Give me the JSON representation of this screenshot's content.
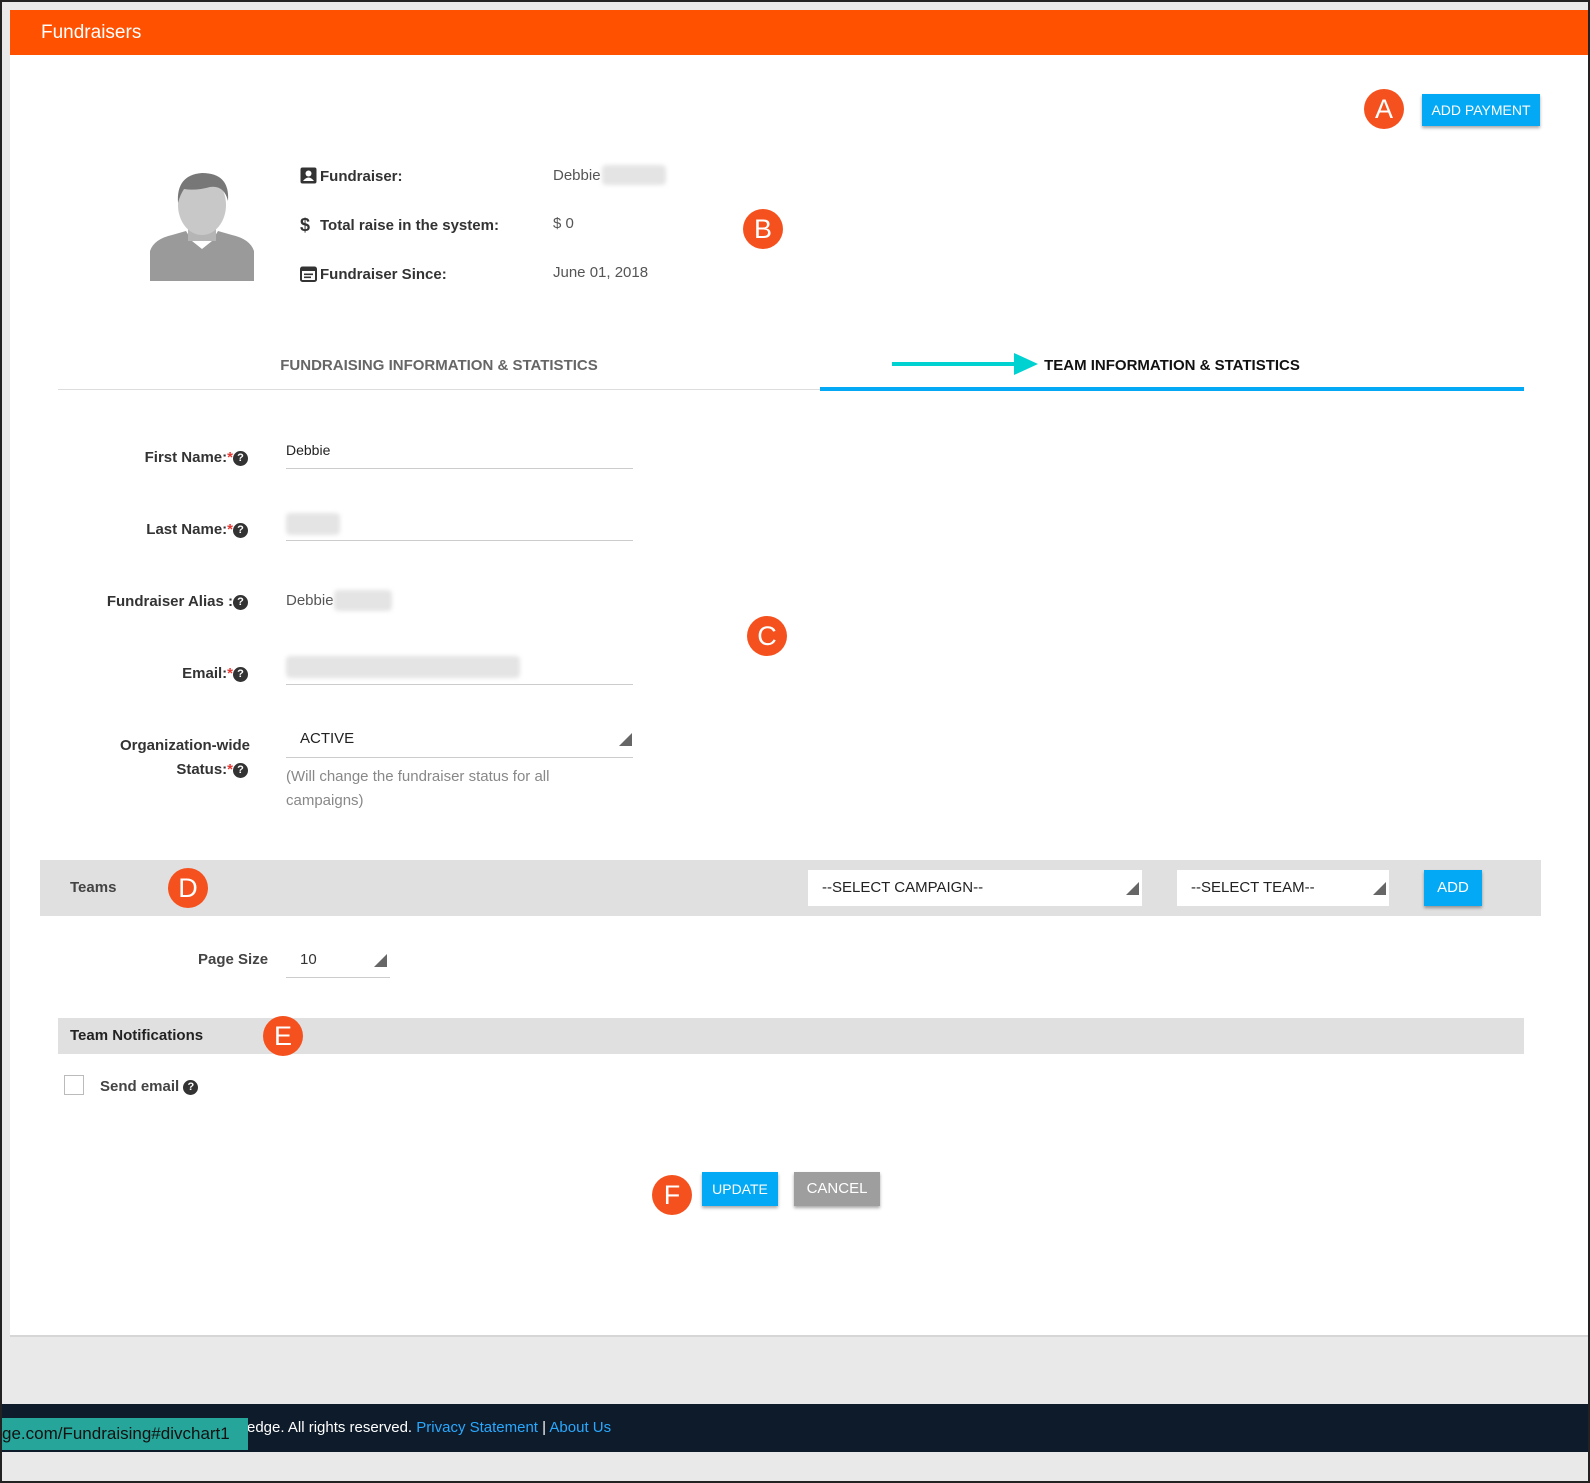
{
  "header": {
    "title": "Fundraisers"
  },
  "markers": {
    "a": "A",
    "b": "B",
    "c": "C",
    "d": "D",
    "e": "E",
    "f": "F"
  },
  "actions": {
    "add_payment": "ADD PAYMENT",
    "update": "UPDATE",
    "cancel": "CANCEL"
  },
  "profile": {
    "fundraiser_label": "Fundraiser:",
    "fundraiser_value": "Debbie",
    "total_label": "Total raise in the system:",
    "total_value": "$ 0",
    "since_label": "Fundraiser Since:",
    "since_value": "June 01, 2018",
    "icons": [
      "person-card-icon",
      "dollar-icon",
      "calendar-icon"
    ]
  },
  "tabs": [
    {
      "label": "FUNDRAISING INFORMATION & STATISTICS",
      "active": false
    },
    {
      "label": "TEAM INFORMATION & STATISTICS",
      "active": true
    }
  ],
  "form": {
    "first_name_label": "First Name:",
    "first_name_value": "Debbie",
    "last_name_label": "Last Name:",
    "alias_label": "Fundraiser Alias :",
    "alias_value": "Debbie",
    "email_label": "Email:",
    "status_label_1": "Organization-wide",
    "status_label_2": "Status:",
    "status_value": "ACTIVE",
    "status_hint": "(Will change the fundraiser status for all campaigns)",
    "required_mark": "*",
    "help_glyph": "?"
  },
  "teams": {
    "title": "Teams",
    "campaign_select": "--SELECT CAMPAIGN--",
    "team_select": "--SELECT TEAM--",
    "add_label": "ADD",
    "page_size_label": "Page Size",
    "page_size_value": "10"
  },
  "notifications": {
    "title": "Team Notifications",
    "send_email_label": "Send email",
    "send_email_checked": false
  },
  "footer": {
    "url_tooltip": "ge.com/Fundraising#divchart1",
    "text": "edge. All rights reserved.",
    "privacy": "Privacy Statement",
    "separator": "|",
    "about": "About Us"
  },
  "colors": {
    "accent_orange": "#ff5100",
    "marker": "#f4511e",
    "primary_blue": "#03a9f4",
    "arrow": "#00d1d1",
    "footer_bg": "#0d1b2a"
  }
}
